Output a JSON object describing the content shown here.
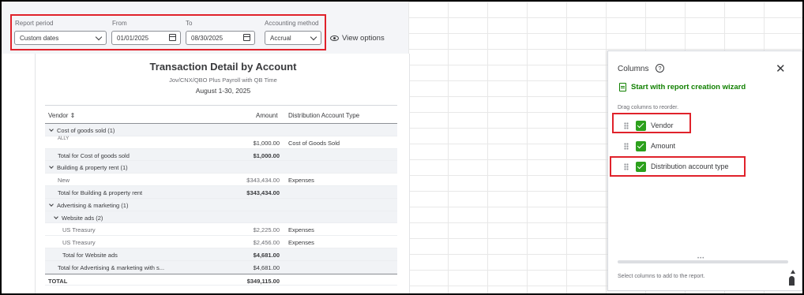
{
  "filters": {
    "report_period_label": "Report period",
    "report_period_value": "Custom dates",
    "from_label": "From",
    "from_value": "01/01/2025",
    "to_label": "To",
    "to_value": "08/30/2025",
    "accounting_method_label": "Accounting method",
    "accounting_method_value": "Accrual",
    "view_options": "View options"
  },
  "report": {
    "title": "Transaction Detail by Account",
    "company": "Jov/CNX/QBO Plus Payroll with QB Time",
    "date_range": "August 1-30, 2025",
    "columns": {
      "vendor": "Vendor ⇕",
      "amount": "Amount",
      "distribution": "Distribution Account Type"
    },
    "rows": [
      {
        "label": "Cost of goods sold (1)",
        "amount": "",
        "dist": ""
      },
      {
        "label": "ALLY",
        "amount": "$1,000.00",
        "dist": "Cost of Goods Sold"
      },
      {
        "label": "Total for Cost of goods sold",
        "amount": "$1,000.00",
        "dist": ""
      },
      {
        "label": "Building & property rent (1)",
        "amount": "",
        "dist": ""
      },
      {
        "label": "New",
        "amount": "$343,434.00",
        "dist": "Expenses"
      },
      {
        "label": "Total for Building & property rent",
        "amount": "$343,434.00",
        "dist": ""
      },
      {
        "label": "Advertising & marketing (1)",
        "amount": "",
        "dist": ""
      },
      {
        "label": "Website ads (2)",
        "amount": "",
        "dist": ""
      },
      {
        "label": "US Treasury",
        "amount": "$2,225.00",
        "dist": "Expenses"
      },
      {
        "label": "US Treasury",
        "amount": "$2,456.00",
        "dist": "Expenses"
      },
      {
        "label": "Total for Website ads",
        "amount": "$4,681.00",
        "dist": ""
      },
      {
        "label": "Total for Advertising & marketing with s...",
        "amount": "$4,681.00",
        "dist": ""
      },
      {
        "label": "TOTAL",
        "amount": "$349,115.00",
        "dist": ""
      }
    ]
  },
  "panel": {
    "title": "Columns",
    "help_icon": "?",
    "close_icon": "✕",
    "wizard_link": "Start with report creation wizard",
    "drag_hint": "Drag columns to reorder.",
    "items": [
      "Vendor",
      "Amount",
      "Distribution account type"
    ],
    "footer_hint": "Select columns to add to the report."
  },
  "colors": {
    "highlight": "#e0222b",
    "checkbox": "#2ca01c",
    "link_green": "#108000"
  }
}
